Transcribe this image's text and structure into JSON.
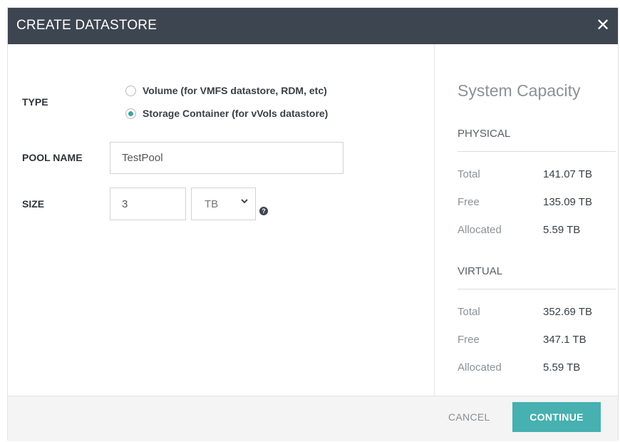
{
  "dialog": {
    "title": "CREATE DATASTORE",
    "close_glyph": "✕"
  },
  "form": {
    "type_label": "TYPE",
    "type_options": [
      {
        "label": "Volume (for VMFS datastore, RDM, etc)",
        "selected": false
      },
      {
        "label": "Storage Container (for vVols datastore)",
        "selected": true
      }
    ],
    "pool_name_label": "POOL NAME",
    "pool_name_value": "TestPool",
    "size_label": "SIZE",
    "size_value": "3",
    "size_unit": "TB",
    "help_glyph": "?"
  },
  "capacity": {
    "title": "System Capacity",
    "physical": {
      "heading": "PHYSICAL",
      "rows": [
        {
          "label": "Total",
          "value": "141.07 TB"
        },
        {
          "label": "Free",
          "value": "135.09 TB"
        },
        {
          "label": "Allocated",
          "value": "5.59 TB"
        }
      ]
    },
    "virtual": {
      "heading": "VIRTUAL",
      "rows": [
        {
          "label": "Total",
          "value": "352.69 TB"
        },
        {
          "label": "Free",
          "value": "347.1 TB"
        },
        {
          "label": "Allocated",
          "value": "5.59 TB"
        }
      ]
    }
  },
  "footer": {
    "cancel_label": "CANCEL",
    "continue_label": "CONTINUE"
  },
  "colors": {
    "titlebar": "#3d4550",
    "accent": "#47b0b0",
    "radio_selected": "#3aa6a3"
  }
}
